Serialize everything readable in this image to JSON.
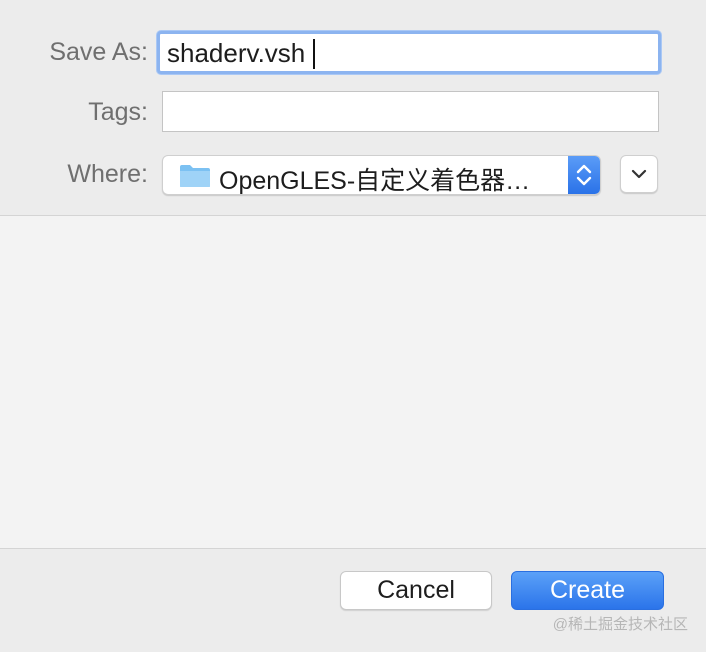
{
  "form": {
    "save_as_label": "Save As:",
    "save_as_value": "shaderv.vsh",
    "tags_label": "Tags:",
    "tags_value": "",
    "where_label": "Where:",
    "where_value": "OpenGLES-自定义着色器…",
    "where_icon": "folder-icon",
    "stepper_icon": "up-down-chevron-icon",
    "expand_icon": "chevron-down-icon"
  },
  "buttons": {
    "cancel_label": "Cancel",
    "create_label": "Create"
  },
  "watermark": {
    "text": "@稀土掘金技术社区"
  },
  "colors": {
    "accent": "#2b74ea",
    "focus_ring": "#8cb4f0",
    "folder": "#7cc1f2",
    "background": "#ececec"
  }
}
